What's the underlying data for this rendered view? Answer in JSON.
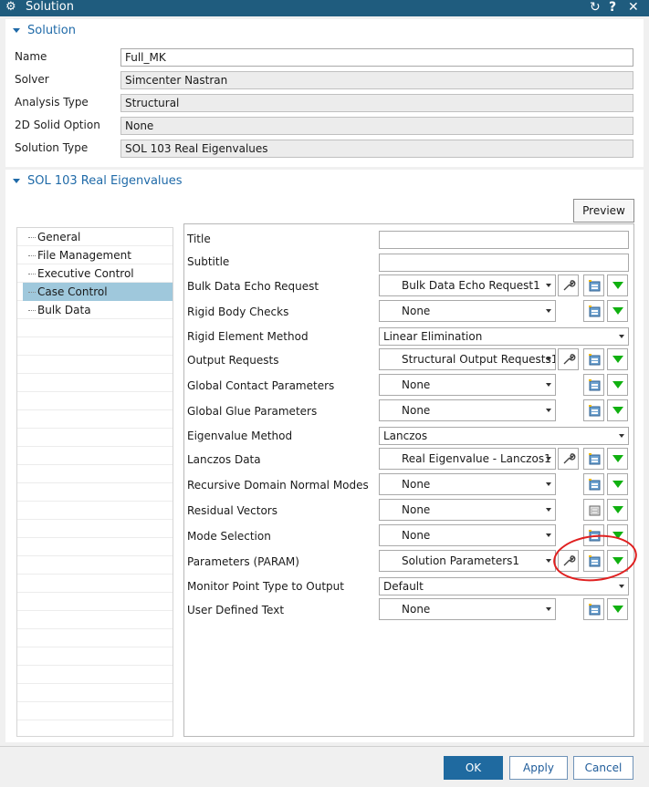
{
  "window": {
    "title": "Solution"
  },
  "solution_section": {
    "header": "Solution",
    "fields": [
      {
        "label": "Name",
        "value": "Full_MK"
      },
      {
        "label": "Solver",
        "value": "Simcenter Nastran"
      },
      {
        "label": "Analysis Type",
        "value": "Structural"
      },
      {
        "label": "2D Solid Option",
        "value": "None"
      },
      {
        "label": "Solution Type",
        "value": "SOL 103 Real Eigenvalues"
      }
    ]
  },
  "sol_section": {
    "header": "SOL 103 Real Eigenvalues",
    "preview_label": "Preview"
  },
  "tree": {
    "items": [
      {
        "label": "General"
      },
      {
        "label": "File Management"
      },
      {
        "label": "Executive Control"
      },
      {
        "label": "Case Control",
        "selected": true
      },
      {
        "label": "Bulk Data"
      }
    ]
  },
  "case_control": {
    "rows": [
      {
        "label": "Title",
        "kind": "text",
        "value": ""
      },
      {
        "label": "Subtitle",
        "kind": "text",
        "value": ""
      },
      {
        "label": "Bulk Data Echo Request",
        "kind": "combo",
        "value": "Bulk Data Echo Request1"
      },
      {
        "label": "Rigid Body Checks",
        "kind": "combo",
        "value": "None"
      },
      {
        "label": "Rigid Element Method",
        "kind": "select",
        "value": "Linear Elimination"
      },
      {
        "label": "Output Requests",
        "kind": "combo",
        "value": "Structural Output Requests1"
      },
      {
        "label": "Global Contact Parameters",
        "kind": "combo",
        "value": "None"
      },
      {
        "label": "Global Glue Parameters",
        "kind": "combo",
        "value": "None"
      },
      {
        "label": "Eigenvalue Method",
        "kind": "select",
        "value": "Lanczos"
      },
      {
        "label": "Lanczos Data",
        "kind": "combo",
        "value": "Real Eigenvalue - Lanczos1"
      },
      {
        "label": "Recursive Domain Normal Modes",
        "kind": "combo",
        "value": "None"
      },
      {
        "label": "Residual Vectors",
        "kind": "combo",
        "value": "None"
      },
      {
        "label": "Mode Selection",
        "kind": "combo",
        "value": "None"
      },
      {
        "label": "Parameters (PARAM)",
        "kind": "combo",
        "value": "Solution Parameters1"
      },
      {
        "label": "Monitor Point Type to Output",
        "kind": "select",
        "value": "Default"
      },
      {
        "label": "User Defined Text",
        "kind": "combo",
        "value": "None"
      }
    ]
  },
  "footer": {
    "ok_label": "OK",
    "apply_label": "Apply",
    "cancel_label": "Cancel"
  },
  "icons": [
    "gear-icon",
    "reset-icon",
    "help-icon",
    "close-icon",
    "triangle-down-icon",
    "wrench-icon",
    "create-table-icon",
    "green-arrow-down-icon"
  ],
  "colors": {
    "title_bar": "#1f5c7e",
    "section_header": "#1f6aa8",
    "selection": "#9fc8dc",
    "ok_button": "#1f6aa0",
    "green_arrow": "#10b010",
    "annotation": "#e02020"
  }
}
